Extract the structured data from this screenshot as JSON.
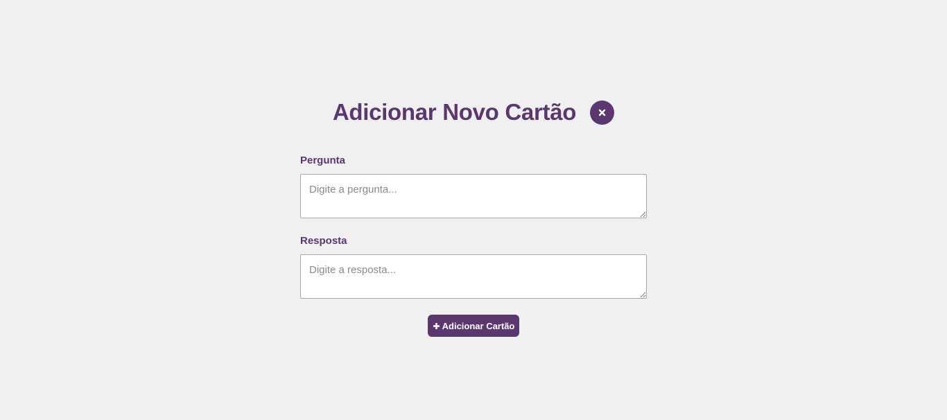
{
  "header": {
    "title": "Adicionar Novo Cartão",
    "close_icon": "close-icon"
  },
  "form": {
    "question": {
      "label": "Pergunta",
      "placeholder": "Digite a pergunta...",
      "value": ""
    },
    "answer": {
      "label": "Resposta",
      "placeholder": "Digite a resposta...",
      "value": ""
    },
    "submit": {
      "icon": "plus-icon",
      "label": "Adicionar Cartão"
    }
  },
  "colors": {
    "accent": "#5b3770",
    "background": "#f0f0f0",
    "input_border": "#a9a9a9"
  }
}
